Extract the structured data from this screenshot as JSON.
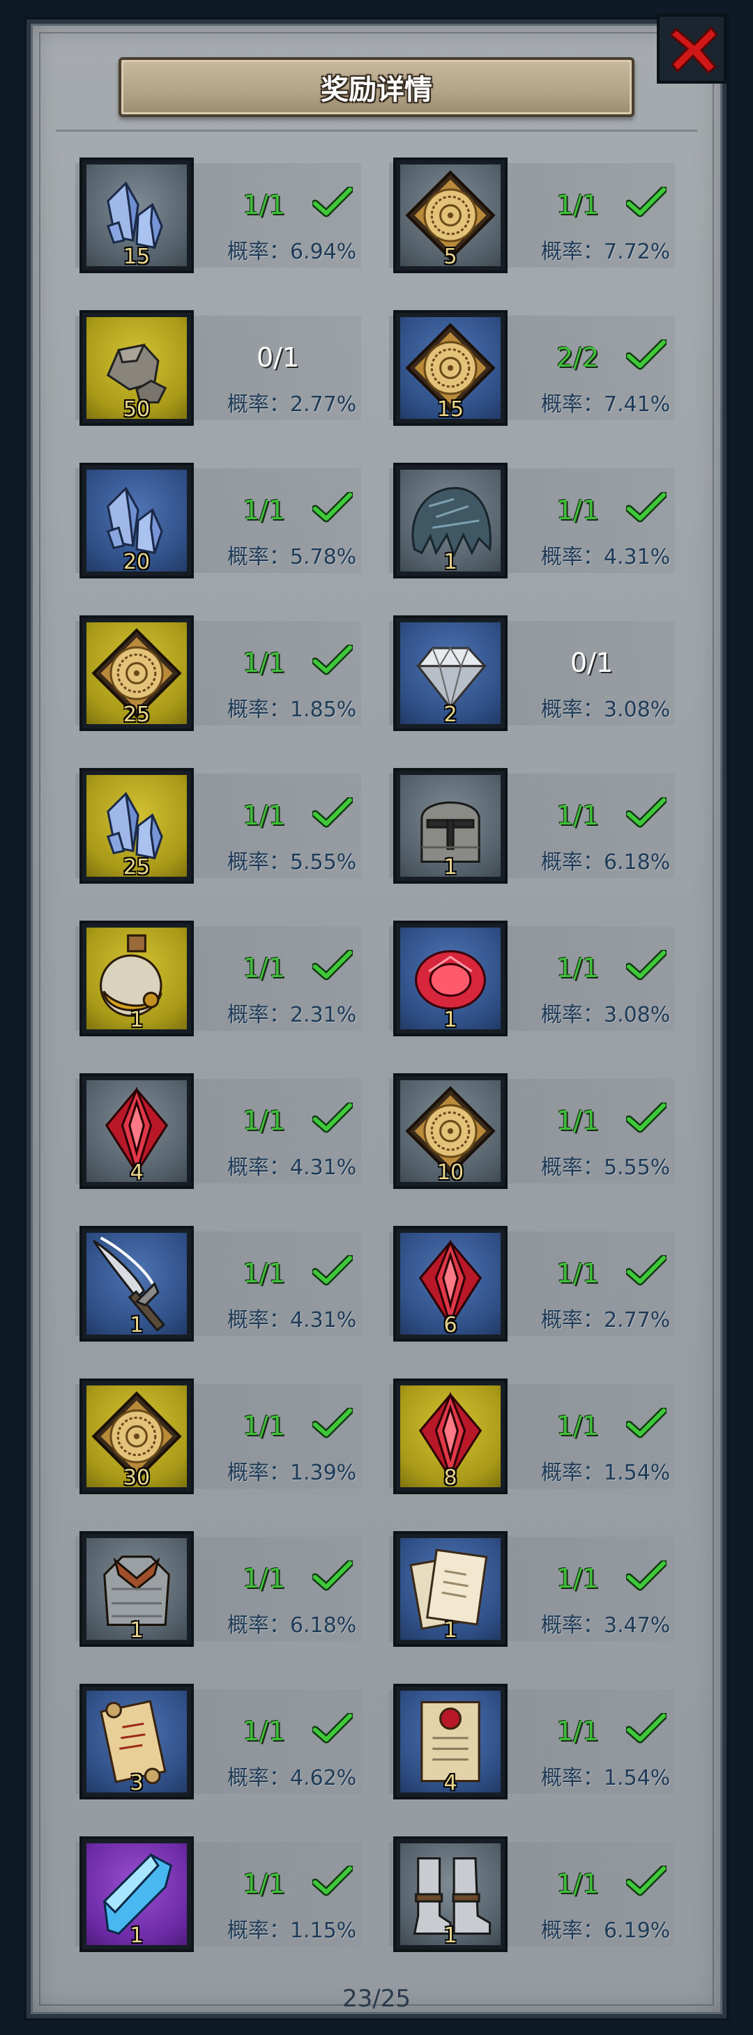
{
  "title": "奖励详情",
  "pager": "23/25",
  "rate_prefix": "概率：",
  "rewards": [
    {
      "icon": "crystal-icon",
      "bg": "gray",
      "qty": "15",
      "progress": "1/1",
      "done": true,
      "rate": "概率：6.94%"
    },
    {
      "icon": "scroll-emblem-icon",
      "bg": "gray",
      "qty": "5",
      "progress": "1/1",
      "done": true,
      "rate": "概率：7.72%"
    },
    {
      "icon": "ore-icon",
      "bg": "yellow",
      "qty": "50",
      "progress": "0/1",
      "done": false,
      "rate": "概率：2.77%"
    },
    {
      "icon": "scroll-emblem-icon",
      "bg": "blue",
      "qty": "15",
      "progress": "2/2",
      "done": true,
      "rate": "概率：7.41%"
    },
    {
      "icon": "crystal-icon",
      "bg": "blue",
      "qty": "20",
      "progress": "1/1",
      "done": true,
      "rate": "概率：5.78%"
    },
    {
      "icon": "hair-icon",
      "bg": "gray",
      "qty": "1",
      "progress": "1/1",
      "done": true,
      "rate": "概率：4.31%"
    },
    {
      "icon": "scroll-emblem-icon",
      "bg": "yellow",
      "qty": "25",
      "progress": "1/1",
      "done": true,
      "rate": "概率：1.85%"
    },
    {
      "icon": "diamond-icon",
      "bg": "blue",
      "qty": "2",
      "progress": "0/1",
      "done": false,
      "rate": "概率：3.08%"
    },
    {
      "icon": "crystal-icon",
      "bg": "yellow",
      "qty": "25",
      "progress": "1/1",
      "done": true,
      "rate": "概率：5.55%"
    },
    {
      "icon": "helmet-icon",
      "bg": "gray",
      "qty": "1",
      "progress": "1/1",
      "done": true,
      "rate": "概率：6.18%"
    },
    {
      "icon": "potion-icon",
      "bg": "yellow",
      "qty": "1",
      "progress": "1/1",
      "done": true,
      "rate": "概率：2.31%"
    },
    {
      "icon": "ruby-icon",
      "bg": "blue",
      "qty": "1",
      "progress": "1/1",
      "done": true,
      "rate": "概率：3.08%"
    },
    {
      "icon": "red-gem-icon",
      "bg": "gray",
      "qty": "4",
      "progress": "1/1",
      "done": true,
      "rate": "概率：4.31%"
    },
    {
      "icon": "scroll-emblem-icon",
      "bg": "gray",
      "qty": "10",
      "progress": "1/1",
      "done": true,
      "rate": "概率：5.55%"
    },
    {
      "icon": "spear-icon",
      "bg": "blue",
      "qty": "1",
      "progress": "1/1",
      "done": true,
      "rate": "概率：4.31%"
    },
    {
      "icon": "red-gem-icon",
      "bg": "blue",
      "qty": "6",
      "progress": "1/1",
      "done": true,
      "rate": "概率：2.77%"
    },
    {
      "icon": "scroll-emblem-icon",
      "bg": "yellow",
      "qty": "30",
      "progress": "1/1",
      "done": true,
      "rate": "概率：1.39%"
    },
    {
      "icon": "red-gem-icon",
      "bg": "yellow",
      "qty": "8",
      "progress": "1/1",
      "done": true,
      "rate": "概率：1.54%"
    },
    {
      "icon": "armor-icon",
      "bg": "gray",
      "qty": "1",
      "progress": "1/1",
      "done": true,
      "rate": "概率：6.18%"
    },
    {
      "icon": "documents-icon",
      "bg": "blue",
      "qty": "1",
      "progress": "1/1",
      "done": true,
      "rate": "概率：3.47%"
    },
    {
      "icon": "map-scroll-icon",
      "bg": "blue",
      "qty": "3",
      "progress": "1/1",
      "done": true,
      "rate": "概率：4.62%"
    },
    {
      "icon": "sealed-scroll-icon",
      "bg": "blue",
      "qty": "4",
      "progress": "1/1",
      "done": true,
      "rate": "概率：1.54%"
    },
    {
      "icon": "blue-crystal-icon",
      "bg": "purple",
      "qty": "1",
      "progress": "1/1",
      "done": true,
      "rate": "概率：1.15%"
    },
    {
      "icon": "boots-icon",
      "bg": "gray",
      "qty": "1",
      "progress": "1/1",
      "done": true,
      "rate": "概率：6.19%"
    }
  ],
  "colors": {
    "progress_done": "#3fbf3a",
    "progress_zero": "#ffffff",
    "rate_text": "#1f3b58",
    "qty_text": "#e8d58c",
    "close_red": "#d01818"
  }
}
